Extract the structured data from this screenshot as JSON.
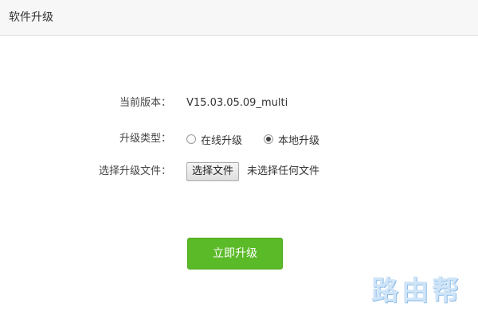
{
  "header": {
    "title": "软件升级"
  },
  "form": {
    "version": {
      "label": "当前版本：",
      "value": "V15.03.05.09_multi"
    },
    "upgrade_type": {
      "label": "升级类型：",
      "options": [
        {
          "label": "在线升级",
          "checked": false
        },
        {
          "label": "本地升级",
          "checked": true
        }
      ]
    },
    "file": {
      "label": "选择升级文件：",
      "button_label": "选择文件",
      "status": "未选择任何文件"
    }
  },
  "upgrade_button": {
    "label": "立即升级"
  },
  "watermark": {
    "text": "路由帮"
  },
  "colors": {
    "accent": "#5bba28",
    "header_bg": "#f7f7f7"
  }
}
